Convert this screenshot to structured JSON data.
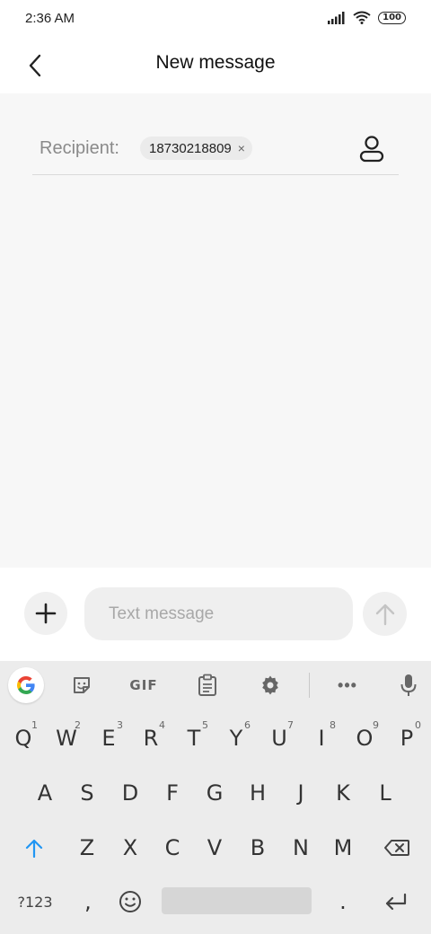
{
  "status_bar": {
    "time": "2:36 AM",
    "battery": "100"
  },
  "app_bar": {
    "title": "New message"
  },
  "recipient": {
    "label": "Recipient:",
    "chip_number": "18730218809",
    "chip_close": "×"
  },
  "compose": {
    "placeholder": "Text message"
  },
  "keyboard": {
    "toolbar_gif": "GIF",
    "toolbar_more": "•••",
    "row1": [
      {
        "k": "Q",
        "h": "1"
      },
      {
        "k": "W",
        "h": "2"
      },
      {
        "k": "E",
        "h": "3"
      },
      {
        "k": "R",
        "h": "4"
      },
      {
        "k": "T",
        "h": "5"
      },
      {
        "k": "Y",
        "h": "6"
      },
      {
        "k": "U",
        "h": "7"
      },
      {
        "k": "I",
        "h": "8"
      },
      {
        "k": "O",
        "h": "9"
      },
      {
        "k": "P",
        "h": "0"
      }
    ],
    "row2": [
      "A",
      "S",
      "D",
      "F",
      "G",
      "H",
      "J",
      "K",
      "L"
    ],
    "row3": [
      "Z",
      "X",
      "C",
      "V",
      "B",
      "N",
      "M"
    ],
    "symbols_key": "?123",
    "comma_key": ",",
    "period_key": "."
  },
  "colors": {
    "accent": "#2196f3",
    "background": "#f7f7f7",
    "keyboard": "#ececec"
  }
}
